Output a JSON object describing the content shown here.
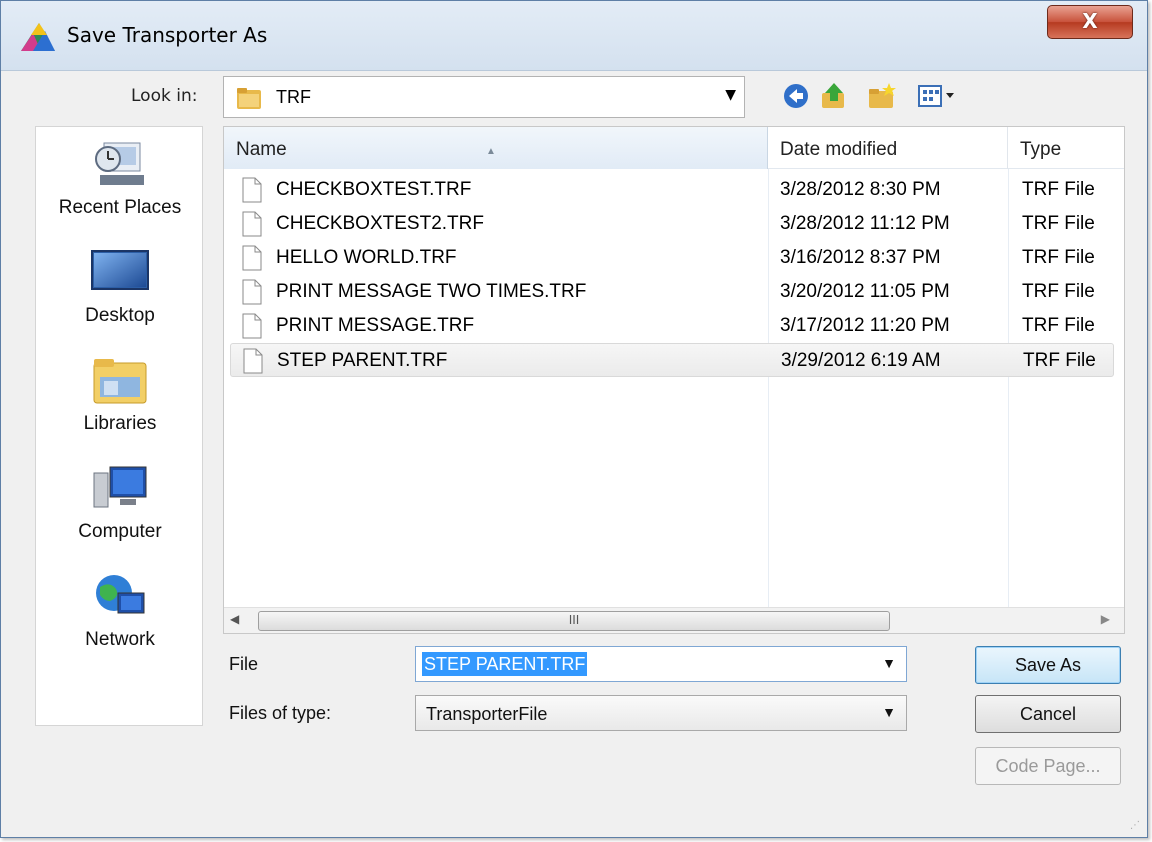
{
  "window": {
    "title": "Save Transporter As",
    "close_label": "X"
  },
  "lookin": {
    "label": "Look in:",
    "value": "TRF"
  },
  "toolbar": {
    "icons": [
      "back-icon",
      "up-folder-icon",
      "new-folder-icon",
      "view-menu-icon"
    ]
  },
  "places": [
    {
      "label": "Recent Places",
      "icon": "recent-places-icon"
    },
    {
      "label": "Desktop",
      "icon": "desktop-icon"
    },
    {
      "label": "Libraries",
      "icon": "libraries-icon"
    },
    {
      "label": "Computer",
      "icon": "computer-icon"
    },
    {
      "label": "Network",
      "icon": "network-icon"
    }
  ],
  "filelist": {
    "columns": {
      "name": "Name",
      "date": "Date modified",
      "type": "Type"
    },
    "rows": [
      {
        "name": "CHECKBOXTEST.TRF",
        "date": "3/28/2012 8:30 PM",
        "type": "TRF File"
      },
      {
        "name": "CHECKBOXTEST2.TRF",
        "date": "3/28/2012 11:12 PM",
        "type": "TRF File"
      },
      {
        "name": "HELLO WORLD.TRF",
        "date": "3/16/2012 8:37 PM",
        "type": "TRF File"
      },
      {
        "name": "PRINT MESSAGE TWO TIMES.TRF",
        "date": "3/20/2012 11:05 PM",
        "type": "TRF File"
      },
      {
        "name": "PRINT MESSAGE.TRF",
        "date": "3/17/2012 11:20 PM",
        "type": "TRF File"
      },
      {
        "name": "STEP PARENT.TRF",
        "date": "3/29/2012 6:19 AM",
        "type": "TRF File"
      }
    ],
    "selected_index": 5,
    "scroll_thumb_glyph": "III"
  },
  "form": {
    "file_label": "File",
    "file_value": "STEP PARENT.TRF",
    "type_label": "Files of type:",
    "type_value": "TransporterFile"
  },
  "buttons": {
    "save": "Save As",
    "cancel": "Cancel",
    "codepage": "Code Page..."
  }
}
